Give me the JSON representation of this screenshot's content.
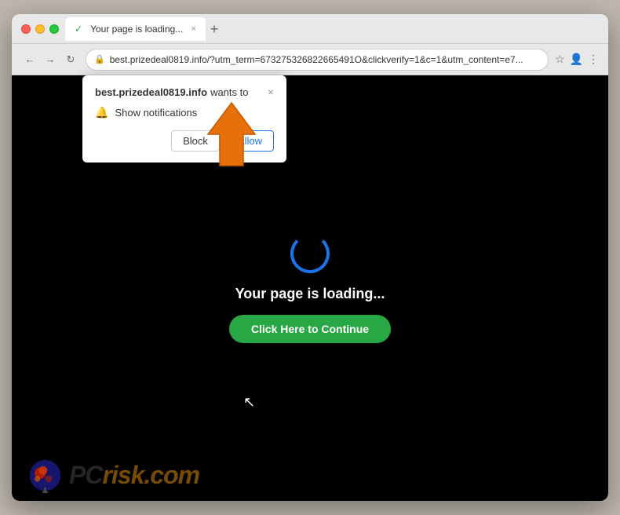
{
  "browser": {
    "tab": {
      "title": "Your page is loading...",
      "favicon": "✓",
      "close": "×",
      "new_tab": "+"
    },
    "nav": {
      "back": "←",
      "forward": "→",
      "refresh": "↻"
    },
    "address": {
      "url": "best.prizedeal0819.info/?utm_term=673275326822665491O&clickverify=1&c=1&utm_content=e7...",
      "lock_icon": "🔒"
    },
    "address_actions": {
      "star": "☆",
      "account": "👤",
      "menu": "⋮"
    }
  },
  "notification_popup": {
    "site": "best.prizedeal0819.info",
    "wants_to": "wants to",
    "close": "×",
    "bell_icon": "🔔",
    "notification_text": "Show notifications",
    "block_label": "Block",
    "allow_label": "Allow"
  },
  "page": {
    "loading_text": "Your page is loading...",
    "continue_button": "Click Here to Continue"
  },
  "watermark": {
    "text_gray": "PC",
    "text_orange": "risk.com"
  }
}
